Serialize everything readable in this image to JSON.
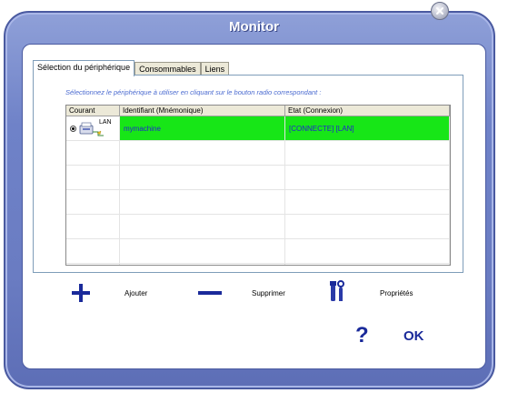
{
  "window": {
    "title": "Monitor"
  },
  "tabs": [
    {
      "label": "Sélection du périphérique",
      "active": true
    },
    {
      "label": "Consommables",
      "active": false
    },
    {
      "label": "Liens",
      "active": false
    }
  ],
  "instruction": "Sélectionnez le périphérique à utiliser en cliquant sur le bouton radio correspondant :",
  "table": {
    "headers": [
      "Courant",
      "Identifiant (Mnémonique)",
      "Etat (Connexion)"
    ],
    "rows": [
      {
        "type_label": "LAN",
        "identifier": "mymachine",
        "status": "[CONNECTE] [LAN]",
        "selected": true
      }
    ]
  },
  "actions": {
    "add_label": "Ajouter",
    "remove_label": "Supprimer",
    "properties_label": "Propriétés"
  },
  "footer": {
    "help": "?",
    "ok_label": "OK"
  },
  "colors": {
    "selected_row": "#17e617",
    "accent_blue": "#1a2a9a",
    "frame": "#6f82c8"
  }
}
